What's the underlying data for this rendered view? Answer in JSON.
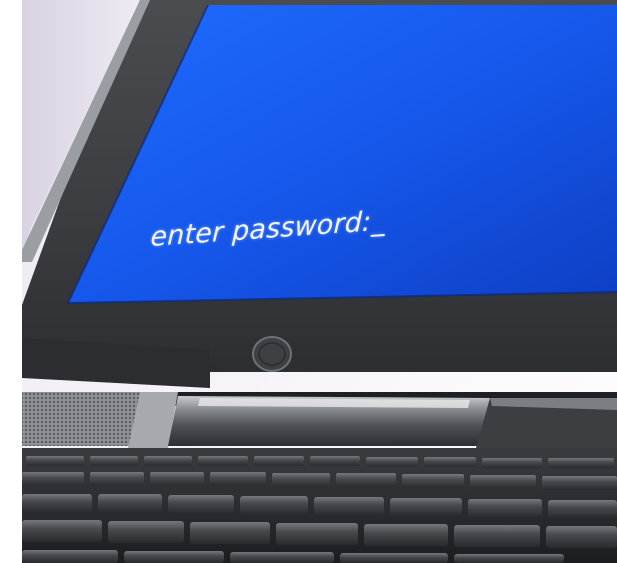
{
  "screen": {
    "prompt_text": "enter password:_",
    "background_color": "#1a5cf0"
  },
  "colors": {
    "bezel": "#3b3d40",
    "keyboard": "#2a2c2f",
    "hinge": "#55585c"
  },
  "icons": {
    "power_button": "power-button-icon"
  }
}
